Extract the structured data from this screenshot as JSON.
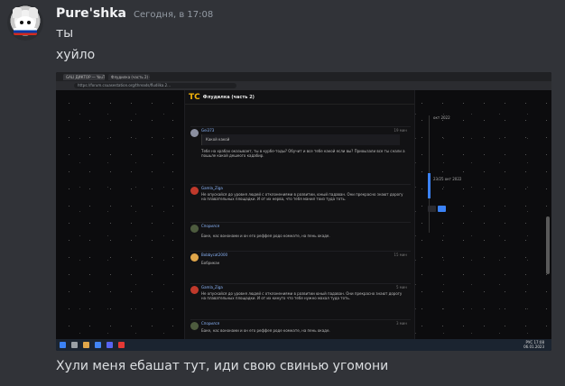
{
  "message": {
    "username": "Pure'shka",
    "timestamp": "Сегодня, в 17:08",
    "lines": [
      "ты",
      "хуйло"
    ],
    "caption": "Хули меня ебашат тут, иди свою свинью угомони"
  },
  "attachment": {
    "tabs": [
      "GALI ДИКТОР — YouTube",
      "Флудилка (часть 2) - Бесплат..."
    ],
    "address": "https://forum.csuasestation.org/threads/fludilka.2...",
    "forum": {
      "logo": "TC",
      "thread_title": "Флудилка (часть 2)",
      "posts": [
        {
          "name": "Gei373",
          "date": "19 мин",
          "text": "Тебе на храбах оказывает, ты в курбе-тоды? Обучит и все тебе какой если вы? Приоызали все ты снали а пошьле какой дешеого кадабир.",
          "quote": "Какой какой"
        },
        {
          "name": "Gamla_Ziga",
          "date": "",
          "text": "Не опускайся до уровня людей с отклонениями в развитии, юный падаван. Они прекрасно знают дорогу на плавательных площадки. И от их нерва, что тебя манил тоиз туда тоть.",
          "quote": ""
        },
        {
          "name": "Спорился",
          "date": "",
          "text": "Баке, нас вононами и он его реффея родо комнате, на пень окаде.",
          "quote": ""
        },
        {
          "name": "Bobbycat2000",
          "date": "15 мин",
          "text": "Бобрикан",
          "quote": ""
        },
        {
          "name": "Gamla_Ziga",
          "date": "5 мин",
          "text": "Не опускайся до уровня людей с отклонениями в развитии юный падаван. Они прекрасно знают дорогу на плавательных площадки. И от их кинуто что тебе нужно махал туда тоть.",
          "quote": ""
        },
        {
          "name": "Спорился",
          "date": "3 мин",
          "text": "Баке, нас вононами и он его реффея роде комнате, на пень окаде.",
          "quote": ""
        }
      ]
    },
    "timeline": {
      "top": "окт 2022",
      "marker": "23/25 окт 2022"
    },
    "clock": {
      "time": "17:08",
      "date": "06.01.2023",
      "lang": "РУС"
    }
  },
  "colors": {
    "bg": "#313338",
    "name": "#f2f3f5",
    "time": "#949ba4",
    "text": "#dbdee1"
  }
}
